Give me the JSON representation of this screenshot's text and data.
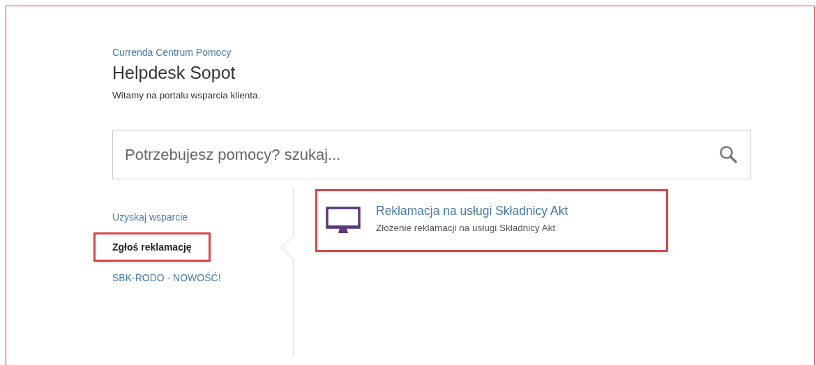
{
  "breadcrumb": "Currenda Centrum Pomocy",
  "title": "Helpdesk Sopot",
  "subtitle": "Witamy na portalu wsparcia klienta.",
  "search": {
    "placeholder": "Potrzebujesz pomocy? szukaj..."
  },
  "sidebar": {
    "items": [
      {
        "label": "Uzyskaj wsparcie",
        "selected": false,
        "highlighted": false
      },
      {
        "label": "Zgłoś reklamację",
        "selected": true,
        "highlighted": true
      },
      {
        "label": "SBK-RODO - NOWOŚĆ!",
        "selected": false,
        "highlighted": false
      }
    ]
  },
  "request_types": [
    {
      "title": "Reklamacja na usługi Składnicy Akt",
      "description": "Złożenie reklamacji na usługi Składnicy Akt",
      "highlighted": true
    }
  ]
}
